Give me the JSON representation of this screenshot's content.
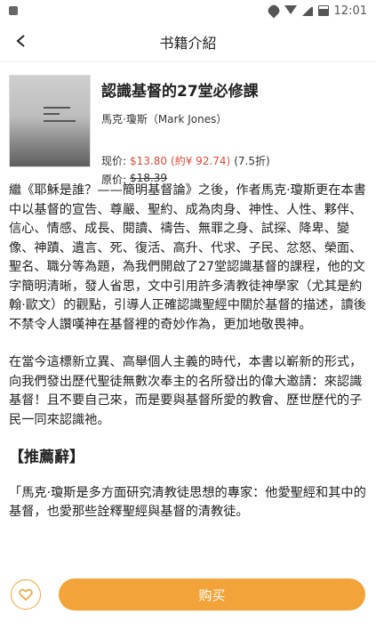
{
  "status_bar": {
    "time": "12:01"
  },
  "nav": {
    "title": "书籍介紹"
  },
  "book": {
    "title": "認識基督的27堂必修課",
    "author": "馬克·瓊斯（Mark Jones）",
    "price_label": "现价:",
    "price_now": "$13.80",
    "price_rmb": "(約¥ 92.74)",
    "discount": "(7.5折)",
    "orig_label": "原价:",
    "orig_price": "$18.39"
  },
  "description": {
    "p1": "繼《耶穌是誰？——簡明基督論》之後，作者馬克·瓊斯更在本書中以基督的宣告、尊嚴、聖約、成為肉身、神性、人性、夥伴、信心、情感、成長、閱讀、禱告、無罪之身、試探、降卑、變像、神蹟、遺言、死、復活、高升、代求、子民、忿怒、榮面、聖名、職分等為題，為我們開啟了27堂認識基督的課程，他的文字簡明清晰，發人省思，文中引用許多清教徒神學家（尤其是約翰·歐文）的觀點，引導人正確認識聖經中關於基督的描述，讀後不禁令人讚嘆神在基督裡的奇妙作為，更加地敬畏神。",
    "p2": "在當今這標新立異、高舉個人主義的時代，本書以嶄新的形式，向我們發出歷代聖徒無數次奉主的名所發出的偉大邀請：來認識基督！且不要自己來，而是要與基督所愛的教會、歷世歷代的子民一同來認識祂。",
    "section_title": "【推薦辭】",
    "p3": "「馬克·瓊斯是多方面研究清教徒思想的專家：他愛聖經和其中的基督，也愛那些詮釋聖經與基督的清教徒。"
  },
  "bottom": {
    "buy_label": "购买"
  },
  "colors": {
    "accent": "#f2a33a",
    "price": "#e04a3a"
  }
}
